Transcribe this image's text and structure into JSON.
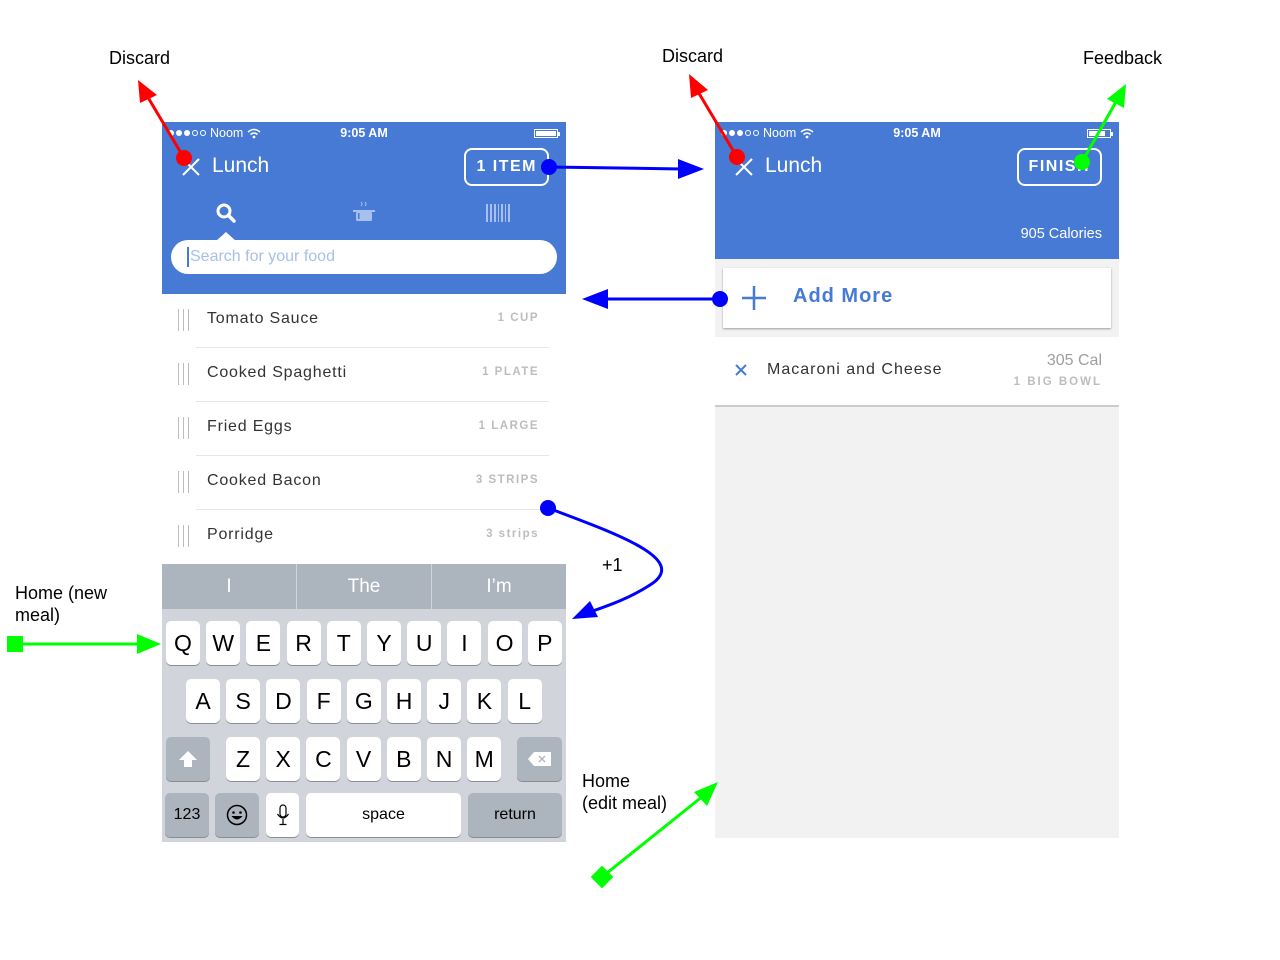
{
  "annotations": {
    "discard_left": "Discard",
    "discard_right": "Discard",
    "feedback": "Feedback",
    "home_new_meal_line1": "Home (new",
    "home_new_meal_line2": "meal)",
    "home_edit_meal_line1": "Home",
    "home_edit_meal_line2": "(edit meal)",
    "plus_one": "+1",
    "colors": {
      "discard": "#ff0000",
      "navigate": "#0000ff",
      "home": "#00ff00"
    }
  },
  "left_screen": {
    "status": {
      "carrier": "Noom",
      "time": "9:05 AM",
      "signal_filled": 3,
      "signal_total": 5
    },
    "title": "Lunch",
    "items_button": "1 ITEM",
    "tabs": [
      {
        "icon": "search-icon",
        "active": true
      },
      {
        "icon": "pot-icon",
        "active": false
      },
      {
        "icon": "barcode-icon",
        "active": false
      }
    ],
    "search": {
      "placeholder": "Search for your food"
    },
    "foods": [
      {
        "name": "Tomato Sauce",
        "qty": "1 CUP"
      },
      {
        "name": "Cooked Spaghetti",
        "qty": "1 PLATE"
      },
      {
        "name": "Fried Eggs",
        "qty": "1 LARGE"
      },
      {
        "name": "Cooked Bacon",
        "qty": "3 STRIPS"
      },
      {
        "name": "Porridge",
        "qty": "3 strips"
      }
    ],
    "keyboard": {
      "suggestions": [
        "I",
        "The",
        "I’m"
      ],
      "row1": [
        "Q",
        "W",
        "E",
        "R",
        "T",
        "Y",
        "U",
        "I",
        "O",
        "P"
      ],
      "row2": [
        "A",
        "S",
        "D",
        "F",
        "G",
        "H",
        "J",
        "K",
        "L"
      ],
      "row3": [
        "Z",
        "X",
        "C",
        "V",
        "B",
        "N",
        "M"
      ],
      "numbers": "123",
      "space": "space",
      "return": "return"
    }
  },
  "right_screen": {
    "status": {
      "carrier": "Noom",
      "time": "9:05 AM"
    },
    "title": "Lunch",
    "finish_button": "FINISH",
    "calories": "905 Calories",
    "add_more": "Add More",
    "meals": [
      {
        "name": "Macaroni and Cheese",
        "calories": "305 Cal",
        "portion": "1 BIG BOWL"
      }
    ]
  },
  "theme": {
    "primary": "#477ad4"
  }
}
